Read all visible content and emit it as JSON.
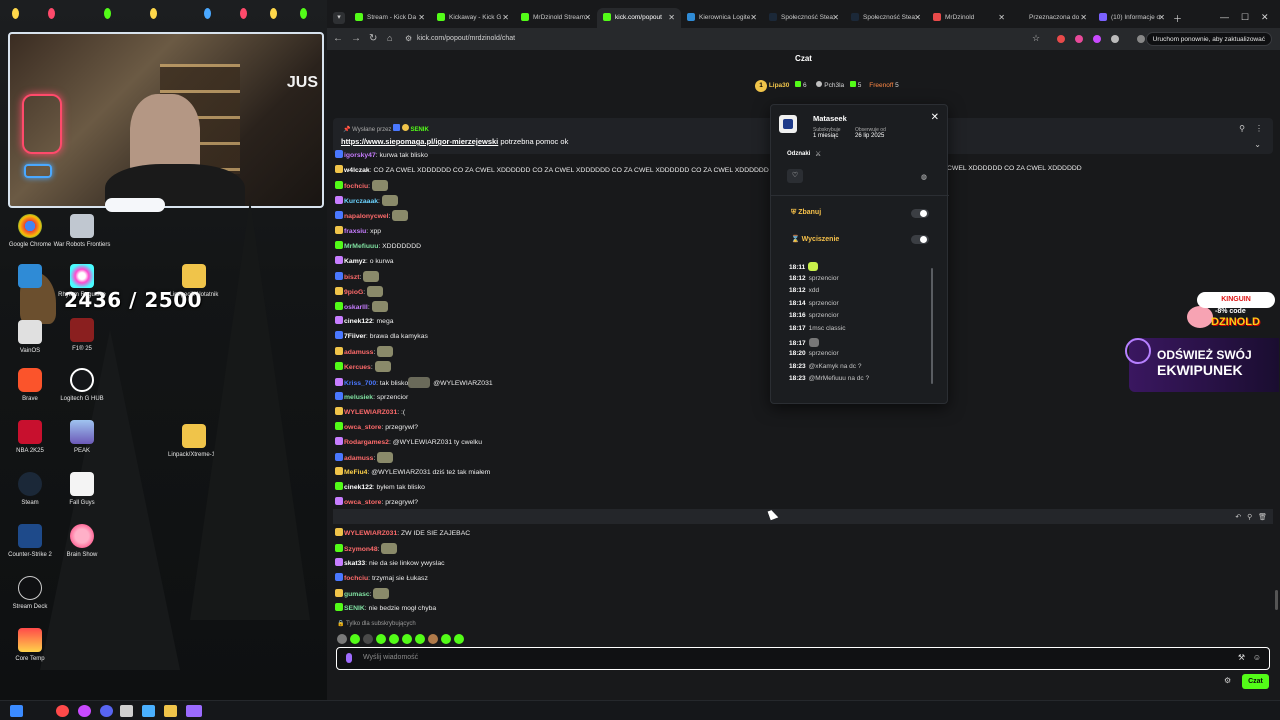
{
  "desktop": {
    "counter": "2436 / 2500",
    "webcam_sign": "JUS",
    "icons": [
      {
        "label": "Google Chrome",
        "icon": "chrome-icon"
      },
      {
        "label": "War Robots Frontiers",
        "icon": "war-robots-icon"
      },
      {
        "label": "",
        "icon": "blue-app-icon"
      },
      {
        "label": "Rhythm Roguelite",
        "icon": "rhythm-icon"
      },
      {
        "label": "Lipspecik Notatnik",
        "icon": "folder-icon"
      },
      {
        "label": "VainOS",
        "icon": "vainos-icon"
      },
      {
        "label": "F1® 25",
        "icon": "f1-icon"
      },
      {
        "label": "Brave",
        "icon": "brave-icon"
      },
      {
        "label": "Logitech G HUB",
        "icon": "logitech-icon"
      },
      {
        "label": "NBA 2K25",
        "icon": "nba-icon"
      },
      {
        "label": "PEAK",
        "icon": "peak-icon"
      },
      {
        "label": "Linpack/Xtreme-1...",
        "icon": "folder-icon"
      },
      {
        "label": "Steam",
        "icon": "steam-icon"
      },
      {
        "label": "Fall Guys",
        "icon": "fallguys-icon"
      },
      {
        "label": "OBS 2025 MAJ",
        "icon": "folder-icon"
      },
      {
        "label": "Counter-Strike 2",
        "icon": "cs2-icon"
      },
      {
        "label": "Brain Show",
        "icon": "brainshow-icon"
      },
      {
        "label": "Stream Deck",
        "icon": "streamdeck-icon"
      },
      {
        "label": "Core Temp",
        "icon": "coretemp-icon"
      }
    ]
  },
  "browser": {
    "tabs": [
      {
        "label": "Stream - Kick Da"
      },
      {
        "label": "Kickaway - Kick G"
      },
      {
        "label": "MrDzinold Stream"
      },
      {
        "label": "kick.com/popout"
      },
      {
        "label": "Kierownica Logite"
      },
      {
        "label": "Społeczność Stea"
      },
      {
        "label": "Społeczność Stea"
      },
      {
        "label": "MrDzinold"
      },
      {
        "label": "Przeznaczona do"
      },
      {
        "label": "(10) Informacje o"
      }
    ],
    "url": "kick.com/popout/mrdzinold/chat",
    "relaunch": "Uruchom ponownie, aby zaktualizować"
  },
  "chat": {
    "title": "Czat",
    "gifters": {
      "first": "Lipa30",
      "first_count": "6",
      "second": "Pch3la",
      "second_count": "5",
      "third": "Freenoff",
      "third_count": "5",
      "rank": "1"
    },
    "pinned": {
      "by_prefix": "Wysłane przez",
      "by_user": "SENIK",
      "link": "https://www.siepomaga.pl/igor-mierzejewski",
      "text": "potrzebna pomoc ok"
    },
    "messages": [
      {
        "user": "igorsky47",
        "text": "kurwa tak blisko",
        "color": "#c77dff"
      },
      {
        "user": "w4lczak",
        "text": "CO ZA CWEL XDDDDDD CO ZA CWEL XDDDDDD CO ZA CWEL XDDDDDD CO ZA CWEL XDDDDDD CO ZA CWEL XDDDDDD",
        "tail": "CWEL XDDDDDD CO ZA CWEL XDDDDDD",
        "color": "#ffffff"
      },
      {
        "user": "fochciu",
        "text": "",
        "color": "#ff6b6b"
      },
      {
        "user": "Kurczaaak",
        "text": "",
        "color": "#6bd3ff"
      },
      {
        "user": "napalonycwel",
        "text": "",
        "color": "#ff6b6b"
      },
      {
        "user": "fraxsiu",
        "text": "xpp",
        "color": "#c77dff"
      },
      {
        "user": "MrMefiuuu",
        "text": "XDDDDDDD",
        "color": "#7fe0a0"
      },
      {
        "user": "Kamyz",
        "text": "o kurwa",
        "color": "#ffffff"
      },
      {
        "user": "biszt",
        "text": "",
        "color": "#ff6b6b"
      },
      {
        "user": "9pioG",
        "text": "",
        "color": "#ff6b6b"
      },
      {
        "user": "oskarlll",
        "text": "",
        "color": "#c77dff"
      },
      {
        "user": "cinek122",
        "text": "mega",
        "color": "#ffffff"
      },
      {
        "user": "7Fiiver",
        "text": "brawa dla kamykas",
        "color": "#ffffff"
      },
      {
        "user": "adamuss",
        "text": "",
        "color": "#ff6b6b"
      },
      {
        "user": "Kercues",
        "text": "",
        "color": "#ff6b6b"
      },
      {
        "user": "Kriss_700",
        "text": "tak blisko",
        "mention": "@WYLEWIARZ031",
        "color": "#4a78ff"
      },
      {
        "user": "melusiek",
        "text": "sprzencior",
        "color": "#7fe0a0"
      },
      {
        "user": "WYLEWIARZ031",
        "text": ":(",
        "color": "#ff6b6b"
      },
      {
        "user": "owca_store",
        "text": "przegrywl?",
        "color": "#ff6b6b"
      },
      {
        "user": "Rodargames2",
        "text": "@WYLEWIARZ031 ty cwelku",
        "color": "#ff6b6b"
      },
      {
        "user": "adamuss",
        "text": "",
        "color": "#ff6b6b"
      },
      {
        "user": "MeFiu4",
        "text": "@WYLEWIARZ031 dziś też tak miałem",
        "color": "#ffd24a"
      },
      {
        "user": "cinek122",
        "text": "byłem tak blisko",
        "color": "#ffffff"
      },
      {
        "user": "owca_store",
        "text": "przegrywl?",
        "color": "#ff6b6b"
      },
      {
        "user": "deliriumtremens",
        "text": "sprzencior",
        "color": "#ff6b6b"
      },
      {
        "user": "WYLEWIARZ031",
        "text": "ZW IDE SIE ZAJEBAC",
        "color": "#ff6b6b"
      },
      {
        "user": "Szymon48",
        "text": "",
        "color": "#ff6b6b"
      },
      {
        "user": "skat33",
        "text": "nie da sie linkow ywyslac",
        "color": "#ffffff"
      },
      {
        "user": "fochciu",
        "text": "trzymaj sie Łukasz",
        "color": "#ff6b6b"
      },
      {
        "user": "gumasc",
        "text": "",
        "color": "#7fe0a0"
      },
      {
        "user": "SENIK",
        "text": "nie bedzie mogł chyba",
        "color": "#7fe0a0"
      }
    ],
    "subs_only": "Tylko dla subskrybujących",
    "input_placeholder": "Wyślij wiadomość",
    "send_label": "Czat"
  },
  "user_card": {
    "username": "Mataseek",
    "sub_label": "Subskrybuje",
    "sub_value": "1 miesiąc",
    "follow_label": "Obserwuje od",
    "follow_value": "26 lip 2025",
    "badges_label": "Odznaki",
    "ban_label": "Zbanuj",
    "mute_label": "Wyciszenie",
    "log": [
      {
        "time": "18:11",
        "text": ""
      },
      {
        "time": "18:12",
        "text": "sprzencior"
      },
      {
        "time": "18:12",
        "text": "xdd"
      },
      {
        "time": "18:14",
        "text": "sprzencior"
      },
      {
        "time": "18:16",
        "text": "sprzencior"
      },
      {
        "time": "18:17",
        "text": "1msc classic"
      },
      {
        "time": "18:17",
        "text": ""
      },
      {
        "time": "18:20",
        "text": "sprzencior"
      },
      {
        "time": "18:23",
        "text": "@xKamyk na dc ?"
      },
      {
        "time": "18:23",
        "text": "@MrMefiuuu na dc ?"
      }
    ]
  },
  "promo": {
    "kinguin": "KINGUIN",
    "discount": "-8% code",
    "code": "DZINOLD",
    "ekwip_line1": "ODŚWIEŻ SWÓJ",
    "ekwip_line2": "EKWIPUNEK"
  },
  "colors": {
    "kick_green": "#53fc18",
    "bg": "#0b0d0f"
  }
}
